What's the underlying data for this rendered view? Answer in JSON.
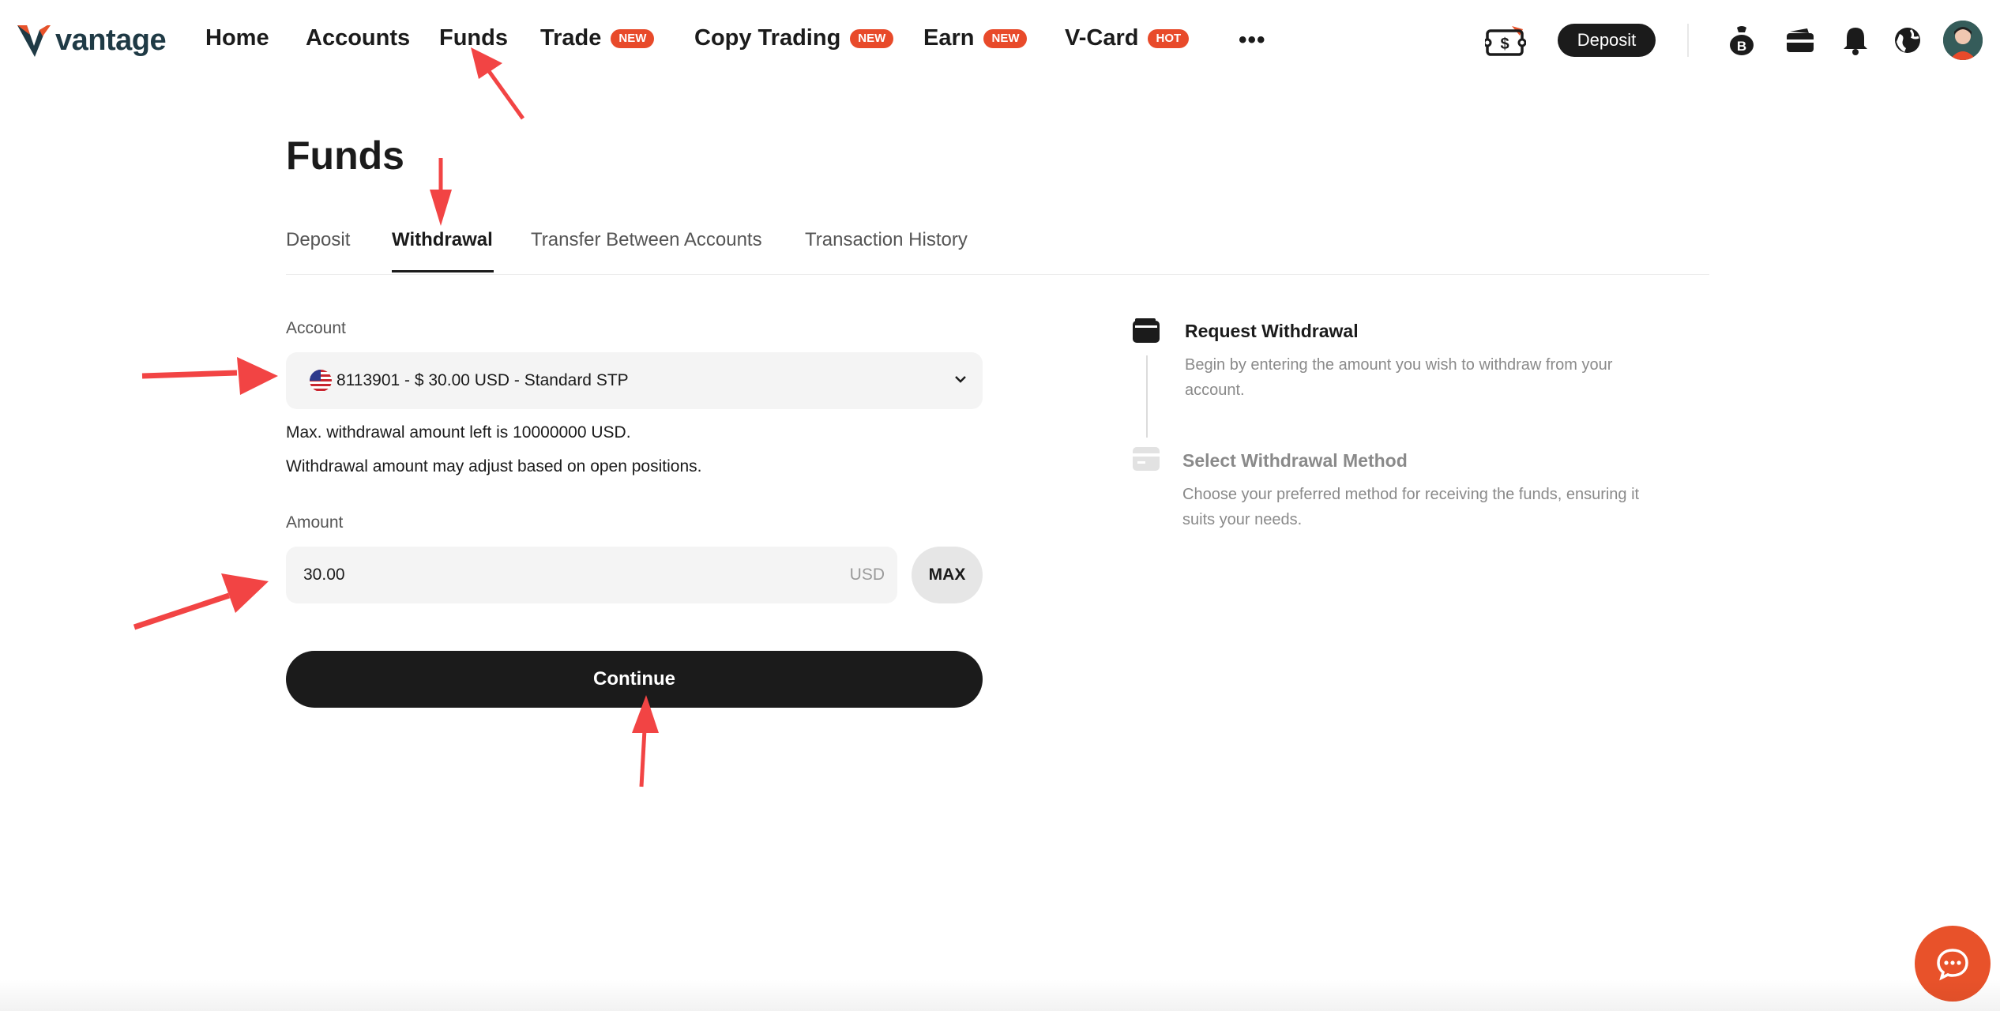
{
  "brand": {
    "name": "vantage",
    "accent": "#e8522a",
    "primary": "#1b1b1b"
  },
  "nav": {
    "items": [
      {
        "label": "Home",
        "badge": ""
      },
      {
        "label": "Accounts",
        "badge": ""
      },
      {
        "label": "Funds",
        "badge": ""
      },
      {
        "label": "Trade",
        "badge": "NEW"
      },
      {
        "label": "Copy Trading",
        "badge": "NEW"
      },
      {
        "label": "Earn",
        "badge": "NEW"
      },
      {
        "label": "V-Card",
        "badge": "HOT"
      }
    ],
    "more": "•••",
    "deposit_label": "Deposit",
    "icons": [
      "cash-voucher-icon",
      "bitcoin-bag-icon",
      "wallet-icon",
      "bell-icon",
      "globe-icon",
      "avatar"
    ]
  },
  "page": {
    "title": "Funds",
    "tabs": [
      {
        "label": "Deposit"
      },
      {
        "label": "Withdrawal"
      },
      {
        "label": "Transfer Between Accounts"
      },
      {
        "label": "Transaction History"
      }
    ],
    "active_tab": "Withdrawal"
  },
  "form": {
    "account_label": "Account",
    "account_value": "8113901 - $ 30.00 USD - Standard STP",
    "max_note": "Max. withdrawal amount left is 10000000 USD.",
    "adjust_note": "Withdrawal amount may adjust based on open positions.",
    "amount_label": "Amount",
    "amount_value": "30.00",
    "currency": "USD",
    "max_label": "MAX",
    "continue_label": "Continue"
  },
  "steps": [
    {
      "title": "Request Withdrawal",
      "desc": "Begin by entering the amount you wish to withdraw from your account.",
      "active": true
    },
    {
      "title": "Select Withdrawal Method",
      "desc": "Choose your preferred method for receiving the funds, ensuring it suits your needs.",
      "active": false
    }
  ]
}
